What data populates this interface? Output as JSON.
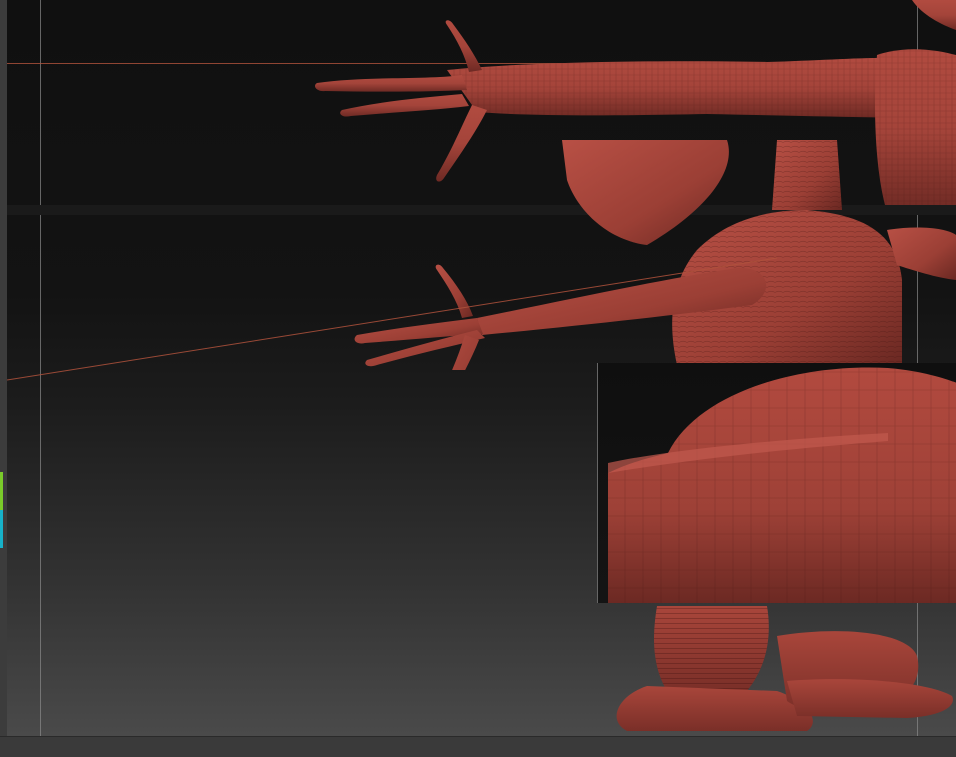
{
  "app": {
    "name": "",
    "model_color": "#a3443a",
    "guide_color": "#b0523c",
    "indicator_colors": [
      "#7acb2a",
      "#17b2c9"
    ]
  },
  "viewport": {
    "description_hidden": ""
  },
  "icons": {
    "status-indicator": "vertical-color-bar"
  }
}
